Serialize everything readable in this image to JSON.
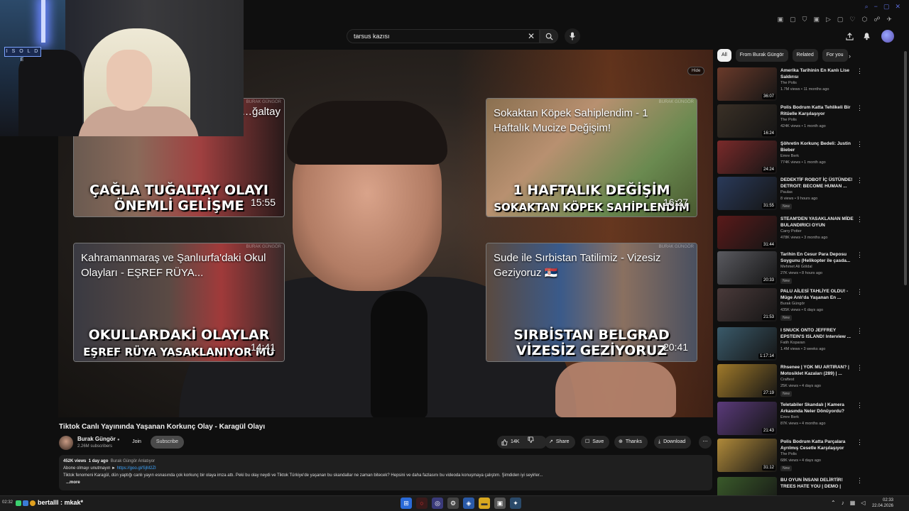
{
  "search": {
    "query": "tarsus kazısı"
  },
  "webcam": {
    "sign": "I S O L D E"
  },
  "video": {
    "hide_label": "Hide",
    "title": "Tiktok Canlı Yayınında Yaşanan Korkunç Olay - Karagül Olayı",
    "channel": "Burak Güngör",
    "subscribers": "2.26M subscribers",
    "join": "Join",
    "subscribe": "Subscribe",
    "likes": "14K",
    "share": "Share",
    "save": "Save",
    "thanks": "Thanks",
    "download": "Download"
  },
  "cards": [
    {
      "title": "…ğaltay",
      "big1": "ÇAĞLA TUĞALTAY OLAYI",
      "big2": "ÖNEMLİ GELİŞME",
      "duration": "15:55"
    },
    {
      "title": "Sokaktan Köpek Sahiplendim - 1 Haftalık Mucize Değişim!",
      "big1": "1 HAFTALIK DEĞİŞİM",
      "big2": "SOKAKTAN KÖPEK SAHİPLENDİM",
      "duration": "16:27"
    },
    {
      "title": "Kahramanmaraş ve Şanlıurfa'daki Okul Olayları - EŞREF RÜYA...",
      "big1": "OKULLARDAKİ OLAYLAR",
      "big2": "EŞREF RÜYA YASAKLANIYOR MU",
      "duration": "14:41"
    },
    {
      "title": "Sude ile Sırbistan Tatilimiz - Vizesiz Geziyoruz 🇷🇸",
      "big1": "SIRBİSTAN BELGRAD",
      "big2": "VİZESİZ GEZİYORUZ",
      "duration": "20:41"
    }
  ],
  "card_watermark": "BURAK GÜNGÖR",
  "description": {
    "views": "452K views",
    "age": "1 day ago",
    "channel_tag": "Burak Güngör Anlatıyor",
    "line1_prefix": "Abone olmayı unutmayın ► ",
    "line1_link": "https://goo.gl/SjM2ZI",
    "line2": "Tiktok fenomeni Karagül, dün yaptığı canlı yayın esnasında çok korkunç bir olaya imza attı. Peki bu olay neydi ve Tiktok Türkiye'de yaşanan bu skandallar ne zaman bitecek? Hepsini ve daha fazlasını bu videoda konuşmaya çalıştım. Şimdiden iyi seyirler...",
    "more": "...more"
  },
  "chips": [
    "All",
    "From Burak Güngör",
    "Related",
    "For you"
  ],
  "recommendations": [
    {
      "title": "Amerika Tarihinin En Kanlı Lise Saldırısı",
      "channel": "The Polis",
      "meta": "1.7M views • 11 months ago",
      "duration": "36:07",
      "new": "",
      "color": "#6a3a2a"
    },
    {
      "title": "Polis Bodrum Katta Tehlikeli Bir Ritüelle Karşılaşıyor",
      "channel": "The Polis",
      "meta": "424K views • 1 month ago",
      "duration": "16:24",
      "new": "",
      "color": "#3a3026"
    },
    {
      "title": "Şöhretin Korkunç Bedeli: Justin Bieber",
      "channel": "Emre Berk",
      "meta": "774K views • 1 month ago",
      "duration": "24:24",
      "new": "",
      "color": "#7a2a2a"
    },
    {
      "title": "DEDEKTİF ROBOT İÇ ÜSTÜNDE! DETROIT: BECOME HUMAN ...",
      "channel": "Paulas",
      "meta": "8 views • 9 hours ago",
      "duration": "31:55",
      "new": "New",
      "color": "#2a3a5a"
    },
    {
      "title": "STEAM'DEN YASAKLANAN MİDE BULANDIRICI OYUN",
      "channel": "Carry Potter",
      "meta": "478K views • 3 months ago",
      "duration": "31:44",
      "new": "",
      "color": "#5a1a1a"
    },
    {
      "title": "Tarihin En Cesur Para Deposu Soygunu (Helikopter ile çasda...",
      "channel": "Mehmet Ali Göldal",
      "meta": "27K views • 8 hours ago",
      "duration": "20:33",
      "new": "New",
      "color": "#5a5a60"
    },
    {
      "title": "PALU AİLESİ TAHLİYE OLDU! - Müge Anlı'da Yaşanan En ...",
      "channel": "Burak Güngör",
      "meta": "435K views • 6 days ago",
      "duration": "21:53",
      "new": "New",
      "color": "#4a3a3a"
    },
    {
      "title": "I SNUCK ONTO JEFFREY EPSTEIN'S ISLAND! Interview ...",
      "channel": "Fatih Koparan",
      "meta": "1.4M views • 3 weeks ago",
      "duration": "1:17:14",
      "new": "",
      "color": "#3a5a6a"
    },
    {
      "title": "Rhsenee | YOK MU ARTIRAN? | Motosiklet Kazaları (289) | ...",
      "channel": "Craftest",
      "meta": "25K views • 4 days ago",
      "duration": "27:19",
      "new": "New",
      "color": "#a07a2a"
    },
    {
      "title": "Teletabiler Skandalı | Kamera Arkasında Neler Dönüyordu?",
      "channel": "Emre Berk",
      "meta": "87K views • 4 months ago",
      "duration": "21:43",
      "new": "",
      "color": "#5a3a7a"
    },
    {
      "title": "Polis Bodrum Katta Parçalara Ayrılmış Cesetle Karşılaşıyor",
      "channel": "The Polis",
      "meta": "68K views • 4 days ago",
      "duration": "31:12",
      "new": "New",
      "color": "#b08a3a"
    },
    {
      "title": "BU OYUN İNSANI DELİRTİR! TREES HATE YOU | DEMO |",
      "channel": "",
      "meta": "",
      "duration": "",
      "new": "",
      "color": "#3a5a2a"
    }
  ],
  "taskbar": {
    "time_left": "02:32",
    "chat": "bertalll : mkak*",
    "clock_time": "02:33",
    "clock_date": "22.04.2026"
  },
  "colors": {
    "accent": "#3ea6ff",
    "bg": "#0f0f0f"
  }
}
